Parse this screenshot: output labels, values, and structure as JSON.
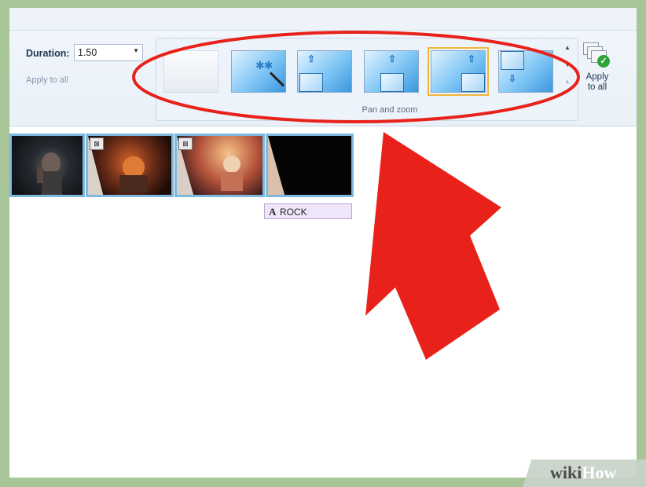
{
  "ribbon": {
    "duration_label": "Duration:",
    "duration_value": "1.50",
    "apply_to_all_left": "Apply to all",
    "group_label": "Pan and zoom",
    "apply_to_all_line1": "Apply",
    "apply_to_all_line2": "to all",
    "presets": [
      {
        "name": "None"
      },
      {
        "name": "Automatic"
      },
      {
        "name": "Pan up along the left"
      },
      {
        "name": "Pan up through center"
      },
      {
        "name": "Pan up along the right"
      },
      {
        "name": "Pan down along the right"
      }
    ],
    "selected_preset_index": 4
  },
  "storyboard": {
    "caption_prefix": "A",
    "caption_text": "ROCK",
    "clips": [
      {
        "name": "clip-1",
        "has_transition": false
      },
      {
        "name": "clip-2",
        "has_transition": true
      },
      {
        "name": "clip-3",
        "has_transition": true
      },
      {
        "name": "clip-4",
        "has_transition": false
      }
    ]
  },
  "annotation_colors": {
    "highlight": "#e8221b"
  },
  "watermark": {
    "part1": "wiki",
    "part2": "How"
  }
}
